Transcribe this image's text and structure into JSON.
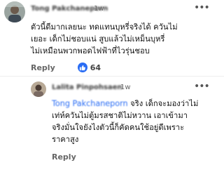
{
  "comments": [
    {
      "author": "Tong Pakchaneporn",
      "time": "1w",
      "lines": [
        "ตัวนี้ดีมากเลยนะ ทดแทนบุหรี่จริงได้ ควันไม่",
        "เยอะ เด็กไม่ชอบแน่ สูบแล้วไม่เหม็นบุหรี่",
        "ไม่เหมือนพวกพอดไฟฟ้าที่ไวรุ่นชอบ"
      ],
      "reply_label": "Reply",
      "likes": "64"
    },
    {
      "author": "Lalita Pinpohsaen",
      "time": "1w",
      "mention": "Tong Pakchaneporn",
      "first_line_rest": " จริง เด็กจะมองว่าไม่",
      "lines": [
        "เท่ห์ควันไม่ตู้มรสชาติไม่หวาน เอาเข้ามา",
        "จริงมั่นใจยังไงตัวนี้ก็คัดคนใช้อยู่ดีเพราะ",
        "ราคาสูง"
      ],
      "reply_label": "Reply"
    }
  ],
  "colors": {
    "link": "#2a6df4",
    "like_badge": "#2a6df4"
  },
  "icons": [
    "avatar",
    "more-options-icon",
    "thumbs-up-icon"
  ]
}
